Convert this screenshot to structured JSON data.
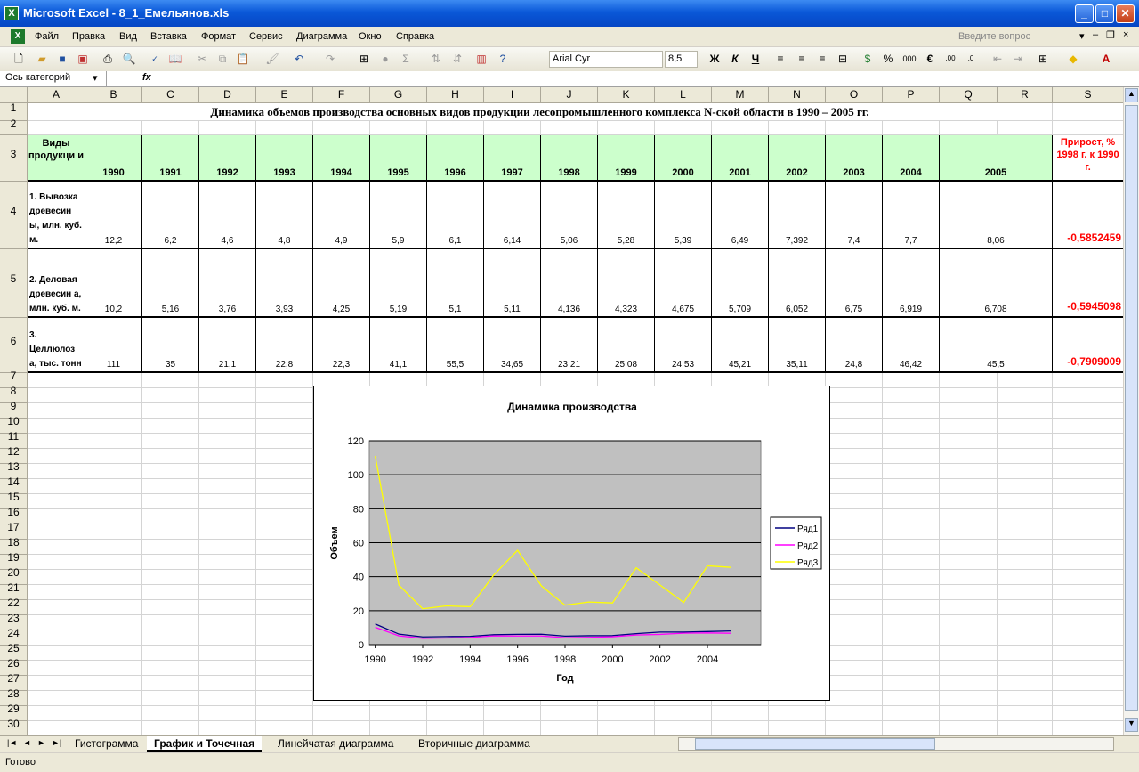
{
  "app": {
    "title": "Microsoft Excel - 8_1_Емельянов.xls"
  },
  "menu": [
    "Файл",
    "Правка",
    "Вид",
    "Вставка",
    "Формат",
    "Сервис",
    "Диаграмма",
    "Окно",
    "Справка"
  ],
  "help_placeholder": "Введите вопрос",
  "toolbar": {
    "font": "Arial Cyr",
    "size": "8,5",
    "bold": "Ж",
    "italic": "К",
    "underline": "Ч"
  },
  "namebox": "Ось категорий",
  "fx": "fx",
  "columns": [
    "A",
    "B",
    "C",
    "D",
    "E",
    "F",
    "G",
    "H",
    "I",
    "J",
    "K",
    "L",
    "M",
    "N",
    "O",
    "P",
    "Q",
    "R",
    "S"
  ],
  "sheet": {
    "title": "Динамика объемов производства основных видов продукции лесопромышленного комплекса N-ской области в 1990 – 2005 гг.",
    "header_first": "Виды продукци и",
    "years": [
      "1990",
      "1991",
      "1992",
      "1993",
      "1994",
      "1995",
      "1996",
      "1997",
      "1998",
      "1999",
      "2000",
      "2001",
      "2002",
      "2003",
      "2004",
      "2005"
    ],
    "growth_header": "Прирост, % 1998 г. к 1990 г.",
    "rows": [
      {
        "label": "1. Вывозка древесин ы, млн. куб. м.",
        "values": [
          "12,2",
          "6,2",
          "4,6",
          "4,8",
          "4,9",
          "5,9",
          "6,1",
          "6,14",
          "5,06",
          "5,28",
          "5,39",
          "6,49",
          "7,392",
          "7,4",
          "7,7",
          "8,06"
        ],
        "growth": "-0,5852459"
      },
      {
        "label": "2. Деловая древесин а, млн. куб. м.",
        "values": [
          "10,2",
          "5,16",
          "3,76",
          "3,93",
          "4,25",
          "5,19",
          "5,1",
          "5,11",
          "4,136",
          "4,323",
          "4,675",
          "5,709",
          "6,052",
          "6,75",
          "6,919",
          "6,708"
        ],
        "growth": "-0,5945098"
      },
      {
        "label": "3. Целлюлоз а, тыс. тонн",
        "values": [
          "111",
          "35",
          "21,1",
          "22,8",
          "22,3",
          "41,1",
          "55,5",
          "34,65",
          "23,21",
          "25,08",
          "24,53",
          "45,21",
          "35,11",
          "24,8",
          "46,42",
          "45,5"
        ],
        "growth": "-0,7909009"
      }
    ]
  },
  "tabs": [
    "Гистограмма",
    "График и Точечная",
    "Линейчатая диаграмма",
    "Вторичные диаграмма"
  ],
  "status": "Готово",
  "chart_data": {
    "type": "line",
    "title": "Динамика производства",
    "xlabel": "Год",
    "ylabel": "Объем",
    "x": [
      1990,
      1991,
      1992,
      1993,
      1994,
      1995,
      1996,
      1997,
      1998,
      1999,
      2000,
      2001,
      2002,
      2003,
      2004,
      2005
    ],
    "xticks": [
      "1990",
      "1992",
      "1994",
      "1996",
      "1998",
      "2000",
      "2002",
      "2004"
    ],
    "ylim": [
      0,
      120
    ],
    "yticks": [
      "0",
      "20",
      "40",
      "60",
      "80",
      "100",
      "120"
    ],
    "legend_position": "right",
    "plot_background": "#c0c0c0",
    "series": [
      {
        "name": "Ряд1",
        "color": "#000080",
        "values": [
          12.2,
          6.2,
          4.6,
          4.8,
          4.9,
          5.9,
          6.1,
          6.14,
          5.06,
          5.28,
          5.39,
          6.49,
          7.392,
          7.4,
          7.7,
          8.06
        ]
      },
      {
        "name": "Ряд2",
        "color": "#ff00ff",
        "values": [
          10.2,
          5.16,
          3.76,
          3.93,
          4.25,
          5.19,
          5.1,
          5.11,
          4.136,
          4.323,
          4.675,
          5.709,
          6.052,
          6.75,
          6.919,
          6.708
        ]
      },
      {
        "name": "Ряд3",
        "color": "#ffff00",
        "values": [
          111,
          35,
          21.1,
          22.8,
          22.3,
          41.1,
          55.5,
          34.65,
          23.21,
          25.08,
          24.53,
          45.21,
          35.11,
          24.8,
          46.42,
          45.5
        ]
      }
    ]
  }
}
